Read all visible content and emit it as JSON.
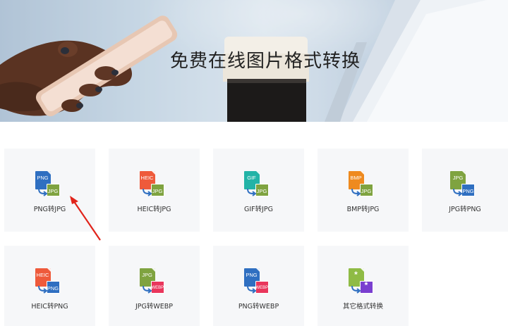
{
  "hero": {
    "title": "免费在线图片格式转换"
  },
  "colors": {
    "png": "#2f6fc1",
    "jpg": "#7fa340",
    "heic": "#ee5a3b",
    "gif": "#22b3a7",
    "bmp": "#ee8a1f",
    "webp": "#e9365c",
    "other_src": "#8fbb45",
    "other_dst": "#7a3fd0",
    "annotation": "#e1241b"
  },
  "tools": [
    {
      "label": "PNG转JPG",
      "src": "PNG",
      "dst": "JPG",
      "src_color": "#2f6fc1",
      "dst_color": "#7fa340"
    },
    {
      "label": "HEIC转JPG",
      "src": "HEIC",
      "dst": "JPG",
      "src_color": "#ee5a3b",
      "dst_color": "#7fa340"
    },
    {
      "label": "GIF转JPG",
      "src": "GIF",
      "dst": "JPG",
      "src_color": "#22b3a7",
      "dst_color": "#7fa340"
    },
    {
      "label": "BMP转JPG",
      "src": "BMP",
      "dst": "JPG",
      "src_color": "#ee8a1f",
      "dst_color": "#7fa340"
    },
    {
      "label": "JPG转PNG",
      "src": "JPG",
      "dst": "PNG",
      "src_color": "#7fa340",
      "dst_color": "#2f6fc1"
    },
    {
      "label": "HEIC转PNG",
      "src": "HEIC",
      "dst": "PNG",
      "src_color": "#ee5a3b",
      "dst_color": "#2f6fc1"
    },
    {
      "label": "JPG转WEBP",
      "src": "JPG",
      "dst": "WEBP",
      "src_color": "#7fa340",
      "dst_color": "#e9365c"
    },
    {
      "label": "PNG转WEBP",
      "src": "PNG",
      "dst": "WEBP",
      "src_color": "#2f6fc1",
      "dst_color": "#e9365c"
    },
    {
      "label": "其它格式转换",
      "src": "*",
      "dst": "*",
      "src_color": "#8fbb45",
      "dst_color": "#7a3fd0"
    }
  ],
  "icons": {
    "arrow": "curved-arrow-icon",
    "annotation": "red-pointer-arrow"
  }
}
